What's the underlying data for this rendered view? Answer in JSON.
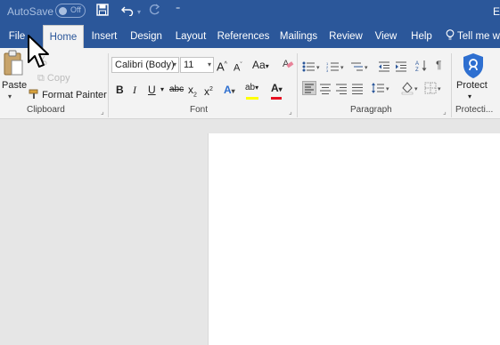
{
  "titlebar": {
    "autosave_label": "AutoSave",
    "autosave_state": "Off",
    "right_partial_label": "E"
  },
  "tabs": [
    {
      "label": "File"
    },
    {
      "label": "Home",
      "active": true
    },
    {
      "label": "Insert"
    },
    {
      "label": "Design"
    },
    {
      "label": "Layout"
    },
    {
      "label": "References"
    },
    {
      "label": "Mailings"
    },
    {
      "label": "Review"
    },
    {
      "label": "View"
    },
    {
      "label": "Help"
    }
  ],
  "tell_me": "Tell me w",
  "clipboard": {
    "paste_label": "Paste",
    "copy_label": "Copy",
    "format_painter_label": "Format Painter",
    "group_label": "Clipboard"
  },
  "font": {
    "font_name": "Calibri (Body)",
    "font_size": "11",
    "change_case_label": "Aa",
    "bold": "B",
    "italic": "I",
    "underline": "U",
    "strike": "abc",
    "subscript": "x",
    "subscript_mark": "2",
    "superscript": "x",
    "superscript_mark": "2",
    "font_color_letter": "A",
    "highlight_letter": "ab",
    "text_effects_letter": "A",
    "grow_label": "A",
    "shrink_label": "A",
    "group_label": "Font"
  },
  "paragraph": {
    "show_marks_label": "¶",
    "group_label": "Paragraph"
  },
  "protect": {
    "label": "Protect",
    "group_label": "Protecti..."
  },
  "colors": {
    "title_bar": "#2b579a",
    "highlight_yellow": "#ffff00",
    "font_red": "#e81123"
  }
}
